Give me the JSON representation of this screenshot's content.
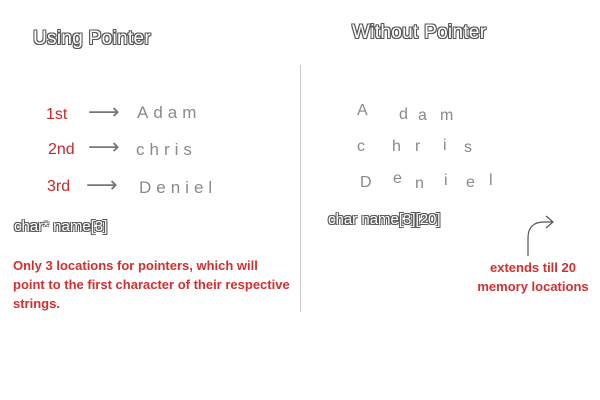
{
  "left": {
    "title": "Using Pointer",
    "rows": [
      {
        "ordinal": "1st",
        "word": "Adam"
      },
      {
        "ordinal": "2nd",
        "word": "chris"
      },
      {
        "ordinal": "3rd",
        "word": "Deniel"
      }
    ],
    "arrow": "⟶",
    "declaration": "char* name[3]",
    "note": "Only 3 locations for pointers, which will point to the first character of their respective strings."
  },
  "right": {
    "title": "Without Pointer",
    "grid": [
      [
        "A",
        "d",
        "a",
        "m"
      ],
      [
        "c",
        "h",
        "r",
        "i",
        "s"
      ],
      [
        "D",
        "e",
        "n",
        "i",
        "e",
        "l"
      ]
    ],
    "declaration": "char name[3][20]",
    "note": "extends till 20 memory locations"
  },
  "colors": {
    "note_red": "#d32f2f",
    "ordinal_red": "#c62828",
    "gray_text": "#8a8a8a",
    "divider": "#c8c8c8"
  }
}
